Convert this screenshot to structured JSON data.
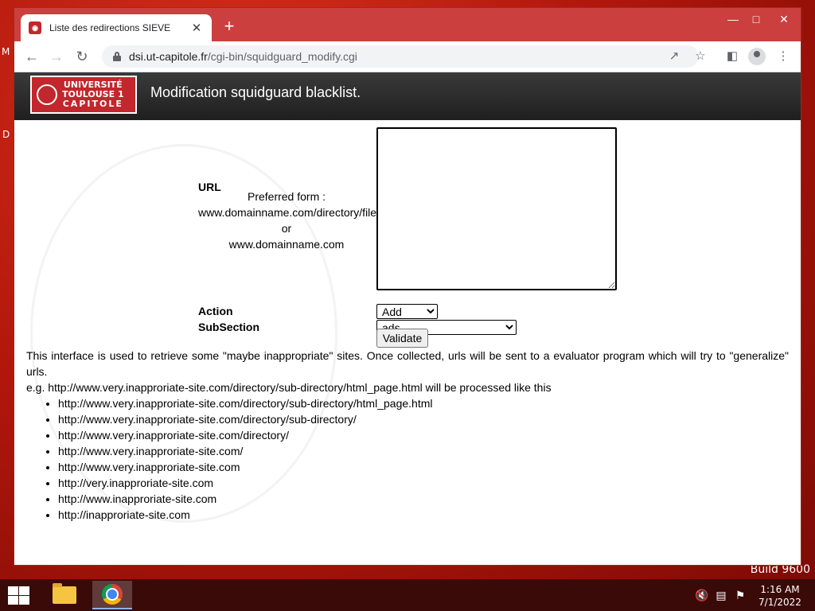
{
  "browser": {
    "tab_title": "Liste des redirections SIEVE",
    "tab_close": "✕",
    "new_tab": "+",
    "url_host": "dsi.ut-capitole.fr",
    "url_path": "/cgi-bin/squidguard_modify.cgi"
  },
  "header": {
    "logo_lines": [
      "UNIVERSITÉ",
      "TOULOUSE 1",
      "CAPITOLE"
    ],
    "title": "Modification squidguard blacklist."
  },
  "form": {
    "url_label": "URL",
    "hint_lines": [
      "Preferred form :",
      "www.domainname.com/directory/file",
      "or",
      "www.domainname.com"
    ],
    "url_value": "",
    "action_label": "Action",
    "action_selected": "Add",
    "subsection_label": "SubSection",
    "subsection_selected": "ads",
    "validate_label": "Validate"
  },
  "info": {
    "description": "This interface is used to retrieve some \"maybe inappropriate\" sites. Once collected, urls will be sent to a evaluator program which will try to \"generalize\" urls.",
    "example_intro": "e.g. http://www.very.inapproriate-site.com/directory/sub-directory/html_page.html will be processed like this",
    "examples": [
      "http://www.very.inapproriate-site.com/directory/sub-directory/html_page.html",
      "http://www.very.inapproriate-site.com/directory/sub-directory/",
      "http://www.very.inapproriate-site.com/directory/",
      "http://www.very.inapproriate-site.com/",
      "http://www.very.inapproriate-site.com",
      "http://very.inapproriate-site.com",
      "http://www.inapproriate-site.com",
      "http://inapproriate-site.com"
    ]
  },
  "desktop": {
    "edge_letters": [
      "M",
      "D"
    ],
    "build_text": "Build 9600"
  },
  "taskbar": {
    "time": "1:16 AM",
    "date": "7/1/2022"
  },
  "colors": {
    "titlebar": "#cc3f3f",
    "logo_red": "#c1272d",
    "header_dark": "#2a2a2a"
  }
}
